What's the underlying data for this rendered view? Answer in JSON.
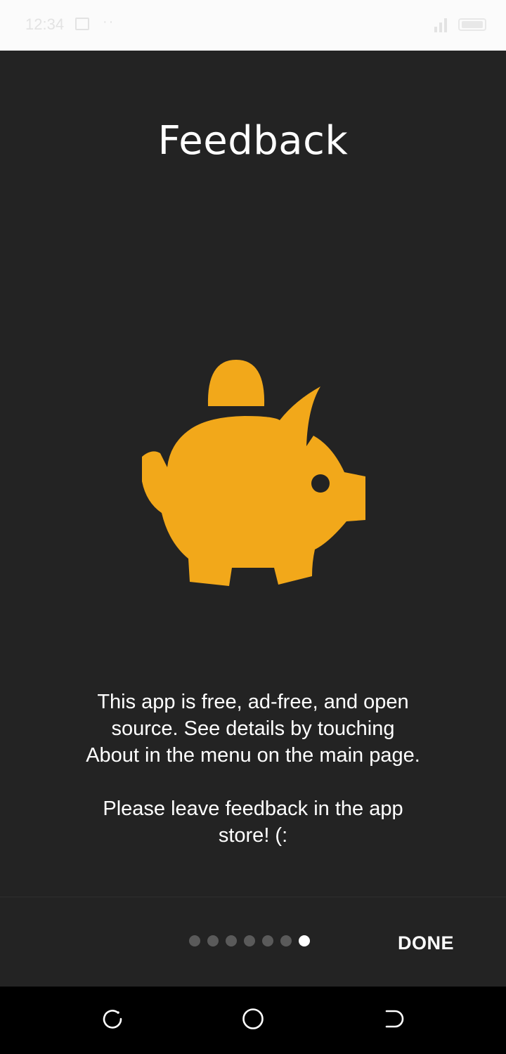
{
  "status_bar": {
    "time": "12:34",
    "dots": "··",
    "icons": [
      "image-icon",
      "signal-icon",
      "battery-icon"
    ]
  },
  "page": {
    "title": "Feedback",
    "illustration": "piggy-bank-icon",
    "accent_color": "#F2A81A",
    "paragraph_1": "This app is free, ad-free, and open source. See details by touching About in the menu on the main page.",
    "paragraph_2": "Please leave feedback in the app store! (:"
  },
  "pager": {
    "total_pages": 7,
    "current_page": 7
  },
  "bottom_bar": {
    "done_label": "DONE"
  },
  "nav_bar": {
    "icons": [
      "recents-icon",
      "home-icon",
      "back-icon"
    ]
  }
}
